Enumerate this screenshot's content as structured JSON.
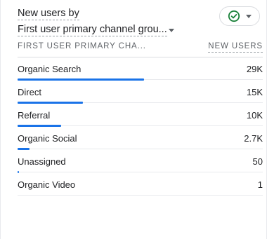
{
  "card": {
    "title_line1": "New users by",
    "title_line2": "First user primary channel grou...",
    "status_icon": "check-circle-icon",
    "status_color": "#188038"
  },
  "table": {
    "col_dimension": "FIRST USER PRIMARY CHA...",
    "col_metric": "NEW USERS",
    "bar_color": "#1a73e8",
    "rows": [
      {
        "label": "Organic Search",
        "value": "29K",
        "fraction": 1.0
      },
      {
        "label": "Direct",
        "value": "15K",
        "fraction": 0.517
      },
      {
        "label": "Referral",
        "value": "10K",
        "fraction": 0.345
      },
      {
        "label": "Organic Social",
        "value": "2.7K",
        "fraction": 0.093
      },
      {
        "label": "Unassigned",
        "value": "50",
        "fraction": 0.004
      },
      {
        "label": "Organic Video",
        "value": "1",
        "fraction": 0.0
      }
    ]
  }
}
